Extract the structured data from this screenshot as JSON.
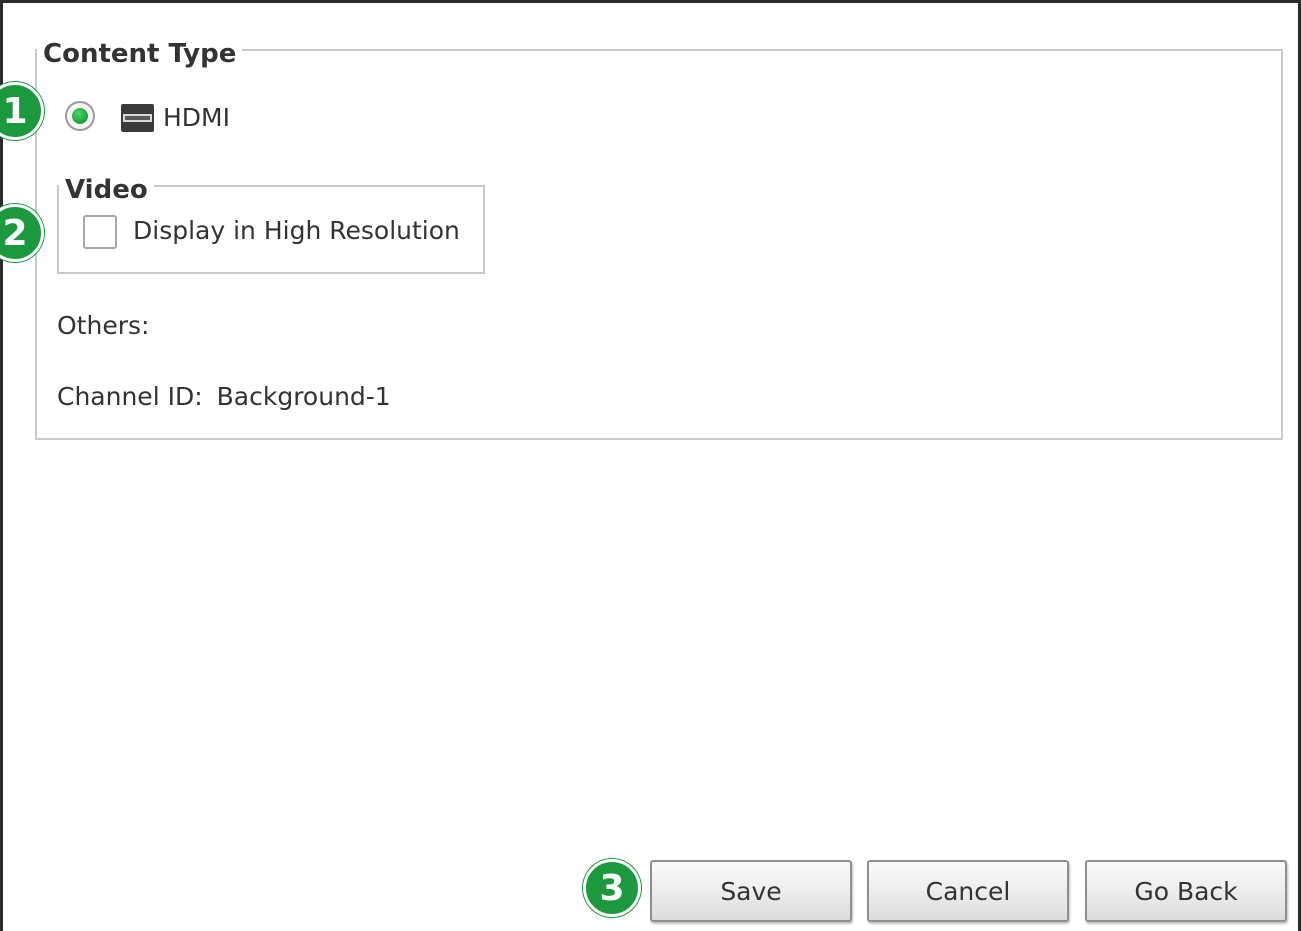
{
  "content_type": {
    "legend": "Content Type",
    "options": [
      {
        "label": "HDMI",
        "selected": true,
        "icon": "hdmi-icon"
      }
    ]
  },
  "video": {
    "legend": "Video",
    "high_resolution": {
      "label": "Display in High Resolution",
      "checked": false
    }
  },
  "others": {
    "label": "Others:",
    "channel_id_label": "Channel ID:",
    "channel_id_value": "Background-1"
  },
  "buttons": {
    "save": "Save",
    "cancel": "Cancel",
    "go_back": "Go Back"
  },
  "callouts": [
    "1",
    "2",
    "3"
  ],
  "colors": {
    "callout": "#1a9a3c",
    "radio_selected": "#16a33a",
    "group_border": "#c9c9c9"
  }
}
